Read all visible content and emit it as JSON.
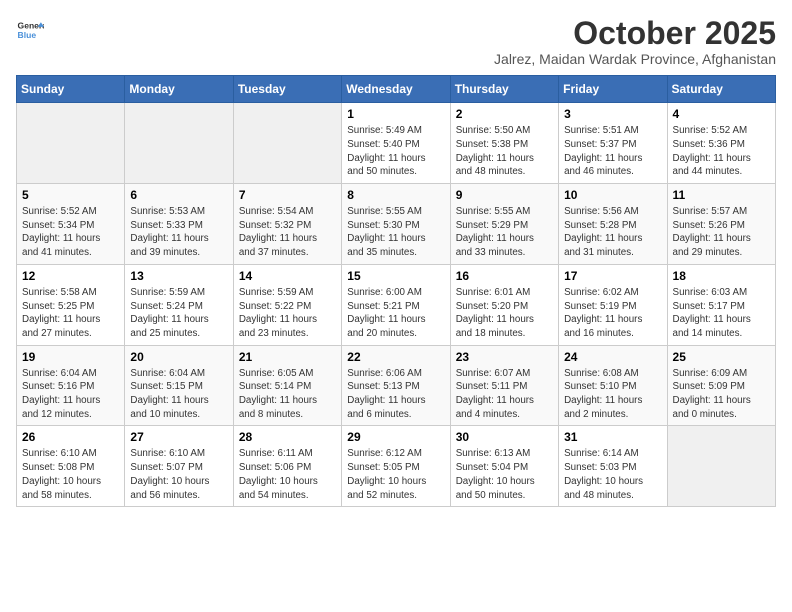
{
  "header": {
    "logo_general": "General",
    "logo_blue": "Blue",
    "month": "October 2025",
    "location": "Jalrez, Maidan Wardak Province, Afghanistan"
  },
  "weekdays": [
    "Sunday",
    "Monday",
    "Tuesday",
    "Wednesday",
    "Thursday",
    "Friday",
    "Saturday"
  ],
  "weeks": [
    [
      {
        "day": "",
        "detail": ""
      },
      {
        "day": "",
        "detail": ""
      },
      {
        "day": "",
        "detail": ""
      },
      {
        "day": "1",
        "detail": "Sunrise: 5:49 AM\nSunset: 5:40 PM\nDaylight: 11 hours\nand 50 minutes."
      },
      {
        "day": "2",
        "detail": "Sunrise: 5:50 AM\nSunset: 5:38 PM\nDaylight: 11 hours\nand 48 minutes."
      },
      {
        "day": "3",
        "detail": "Sunrise: 5:51 AM\nSunset: 5:37 PM\nDaylight: 11 hours\nand 46 minutes."
      },
      {
        "day": "4",
        "detail": "Sunrise: 5:52 AM\nSunset: 5:36 PM\nDaylight: 11 hours\nand 44 minutes."
      }
    ],
    [
      {
        "day": "5",
        "detail": "Sunrise: 5:52 AM\nSunset: 5:34 PM\nDaylight: 11 hours\nand 41 minutes."
      },
      {
        "day": "6",
        "detail": "Sunrise: 5:53 AM\nSunset: 5:33 PM\nDaylight: 11 hours\nand 39 minutes."
      },
      {
        "day": "7",
        "detail": "Sunrise: 5:54 AM\nSunset: 5:32 PM\nDaylight: 11 hours\nand 37 minutes."
      },
      {
        "day": "8",
        "detail": "Sunrise: 5:55 AM\nSunset: 5:30 PM\nDaylight: 11 hours\nand 35 minutes."
      },
      {
        "day": "9",
        "detail": "Sunrise: 5:55 AM\nSunset: 5:29 PM\nDaylight: 11 hours\nand 33 minutes."
      },
      {
        "day": "10",
        "detail": "Sunrise: 5:56 AM\nSunset: 5:28 PM\nDaylight: 11 hours\nand 31 minutes."
      },
      {
        "day": "11",
        "detail": "Sunrise: 5:57 AM\nSunset: 5:26 PM\nDaylight: 11 hours\nand 29 minutes."
      }
    ],
    [
      {
        "day": "12",
        "detail": "Sunrise: 5:58 AM\nSunset: 5:25 PM\nDaylight: 11 hours\nand 27 minutes."
      },
      {
        "day": "13",
        "detail": "Sunrise: 5:59 AM\nSunset: 5:24 PM\nDaylight: 11 hours\nand 25 minutes."
      },
      {
        "day": "14",
        "detail": "Sunrise: 5:59 AM\nSunset: 5:22 PM\nDaylight: 11 hours\nand 23 minutes."
      },
      {
        "day": "15",
        "detail": "Sunrise: 6:00 AM\nSunset: 5:21 PM\nDaylight: 11 hours\nand 20 minutes."
      },
      {
        "day": "16",
        "detail": "Sunrise: 6:01 AM\nSunset: 5:20 PM\nDaylight: 11 hours\nand 18 minutes."
      },
      {
        "day": "17",
        "detail": "Sunrise: 6:02 AM\nSunset: 5:19 PM\nDaylight: 11 hours\nand 16 minutes."
      },
      {
        "day": "18",
        "detail": "Sunrise: 6:03 AM\nSunset: 5:17 PM\nDaylight: 11 hours\nand 14 minutes."
      }
    ],
    [
      {
        "day": "19",
        "detail": "Sunrise: 6:04 AM\nSunset: 5:16 PM\nDaylight: 11 hours\nand 12 minutes."
      },
      {
        "day": "20",
        "detail": "Sunrise: 6:04 AM\nSunset: 5:15 PM\nDaylight: 11 hours\nand 10 minutes."
      },
      {
        "day": "21",
        "detail": "Sunrise: 6:05 AM\nSunset: 5:14 PM\nDaylight: 11 hours\nand 8 minutes."
      },
      {
        "day": "22",
        "detail": "Sunrise: 6:06 AM\nSunset: 5:13 PM\nDaylight: 11 hours\nand 6 minutes."
      },
      {
        "day": "23",
        "detail": "Sunrise: 6:07 AM\nSunset: 5:11 PM\nDaylight: 11 hours\nand 4 minutes."
      },
      {
        "day": "24",
        "detail": "Sunrise: 6:08 AM\nSunset: 5:10 PM\nDaylight: 11 hours\nand 2 minutes."
      },
      {
        "day": "25",
        "detail": "Sunrise: 6:09 AM\nSunset: 5:09 PM\nDaylight: 11 hours\nand 0 minutes."
      }
    ],
    [
      {
        "day": "26",
        "detail": "Sunrise: 6:10 AM\nSunset: 5:08 PM\nDaylight: 10 hours\nand 58 minutes."
      },
      {
        "day": "27",
        "detail": "Sunrise: 6:10 AM\nSunset: 5:07 PM\nDaylight: 10 hours\nand 56 minutes."
      },
      {
        "day": "28",
        "detail": "Sunrise: 6:11 AM\nSunset: 5:06 PM\nDaylight: 10 hours\nand 54 minutes."
      },
      {
        "day": "29",
        "detail": "Sunrise: 6:12 AM\nSunset: 5:05 PM\nDaylight: 10 hours\nand 52 minutes."
      },
      {
        "day": "30",
        "detail": "Sunrise: 6:13 AM\nSunset: 5:04 PM\nDaylight: 10 hours\nand 50 minutes."
      },
      {
        "day": "31",
        "detail": "Sunrise: 6:14 AM\nSunset: 5:03 PM\nDaylight: 10 hours\nand 48 minutes."
      },
      {
        "day": "",
        "detail": ""
      }
    ]
  ]
}
